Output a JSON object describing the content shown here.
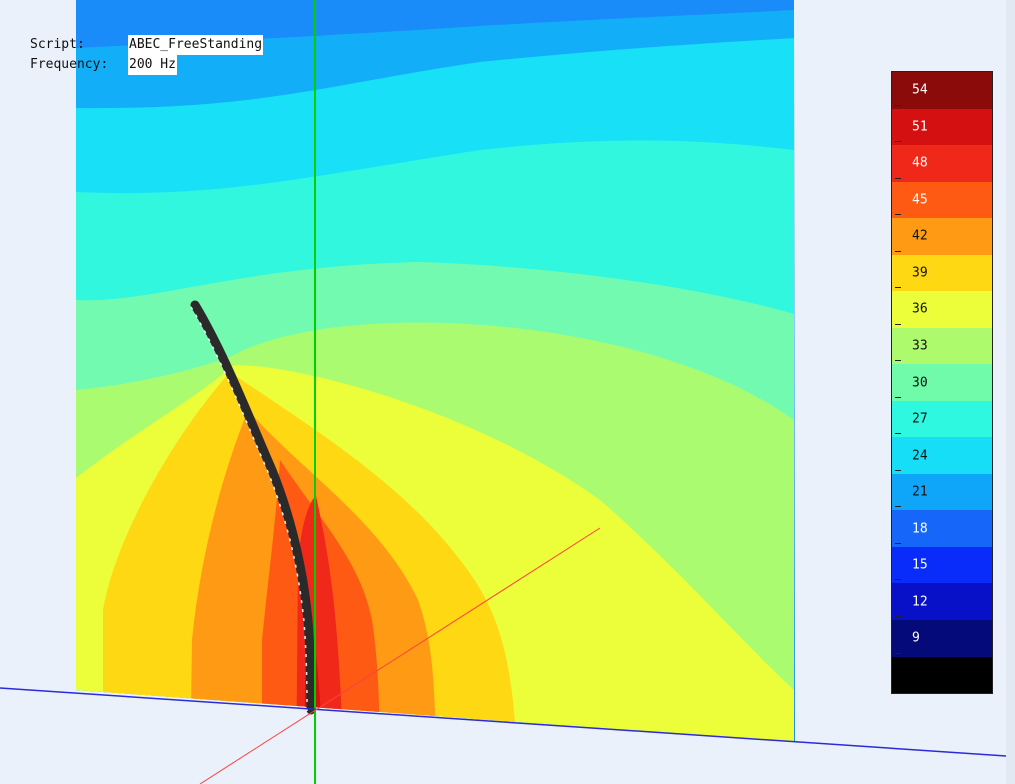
{
  "info": {
    "script_label": "Script:",
    "script_value": "ABEC_FreeStanding",
    "frequency_label": "Frequency:",
    "frequency_value": "200 Hz"
  },
  "legend": {
    "levels": [
      {
        "label": "54",
        "color": "#8b0a0a",
        "text_color": "#ffffff"
      },
      {
        "label": "51",
        "color": "#d41010",
        "text_color": "#ffffff"
      },
      {
        "label": "48",
        "color": "#f0281a",
        "text_color": "#ffffff"
      },
      {
        "label": "45",
        "color": "#ff5a14",
        "text_color": "#ffffff"
      },
      {
        "label": "42",
        "color": "#ff9a14",
        "text_color": "#111111"
      },
      {
        "label": "39",
        "color": "#ffd814",
        "text_color": "#111111"
      },
      {
        "label": "36",
        "color": "#ecfe3a",
        "text_color": "#111111"
      },
      {
        "label": "33",
        "color": "#adfb6c",
        "text_color": "#111111"
      },
      {
        "label": "30",
        "color": "#6ffbaa",
        "text_color": "#111111"
      },
      {
        "label": "27",
        "color": "#2ff8e0",
        "text_color": "#111111"
      },
      {
        "label": "24",
        "color": "#16def7",
        "text_color": "#111111"
      },
      {
        "label": "21",
        "color": "#0fa6fa",
        "text_color": "#111111"
      },
      {
        "label": "18",
        "color": "#1766fa",
        "text_color": "#ffffff"
      },
      {
        "label": "15",
        "color": "#0a2cfa",
        "text_color": "#ffffff"
      },
      {
        "label": "12",
        "color": "#0810c8",
        "text_color": "#ffffff"
      },
      {
        "label": "9",
        "color": "#050a7a",
        "text_color": "#ffffff"
      },
      {
        "label": "",
        "color": "#000000",
        "text_color": "#ffffff"
      }
    ]
  },
  "field_colors": {
    "c15": "#1a8cfa",
    "c18": "#12aff8",
    "c24": "#18e0f6",
    "c27": "#30f7de",
    "c30": "#72fbb0",
    "c33": "#aafb70",
    "c36": "#ecfe3a",
    "c39": "#ffd814",
    "c42": "#ff9a14",
    "c45": "#ff5a14",
    "c48": "#f0281a",
    "c51": "#d41010"
  },
  "axes": {
    "x_color": "#ff4040",
    "y_color": "#00d000",
    "z_color": "#2b2bd8"
  }
}
